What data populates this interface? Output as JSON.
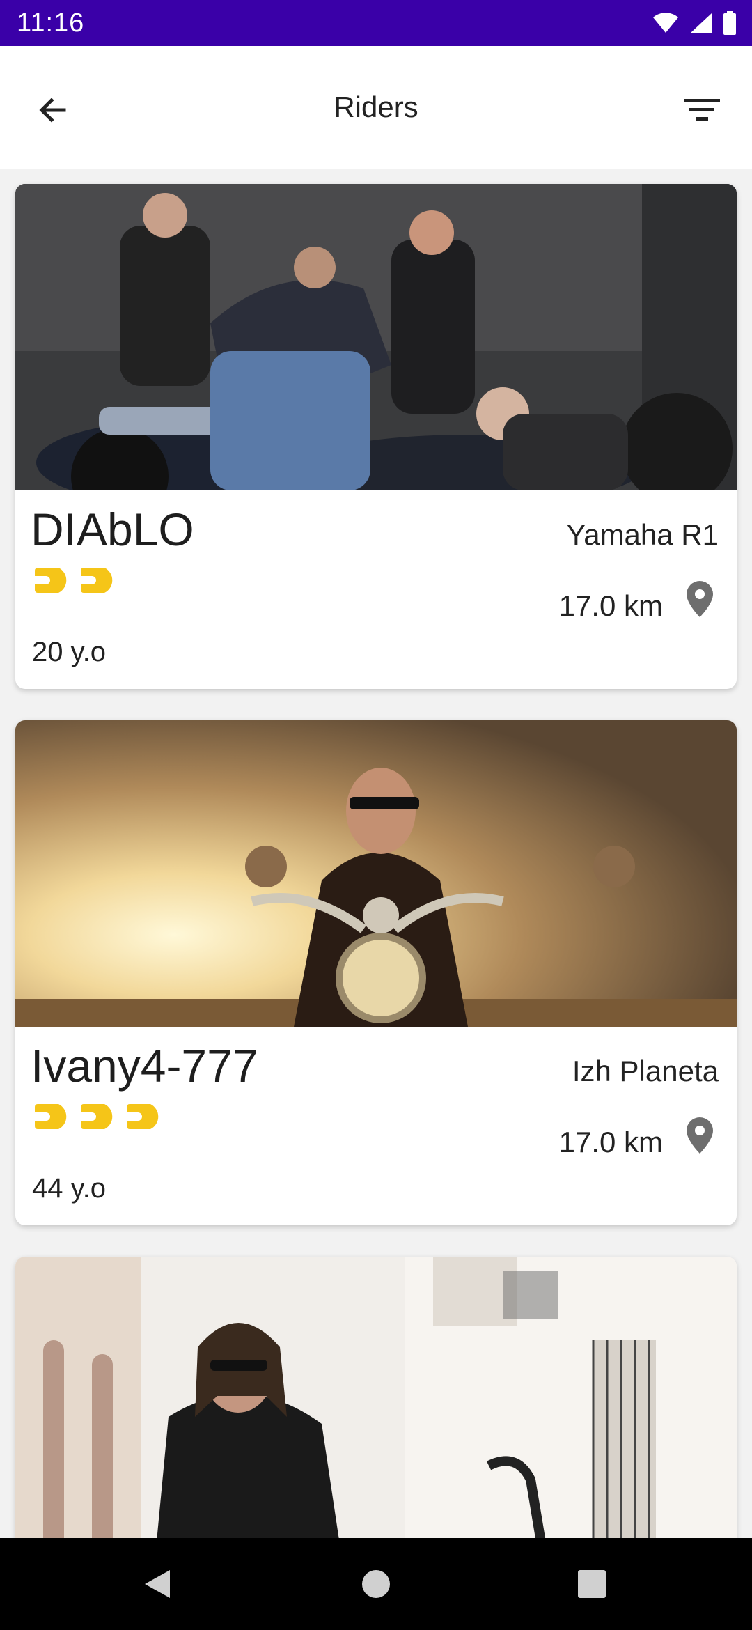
{
  "status_bar": {
    "time": "11:16",
    "background": "#3a00a8",
    "icons": [
      "wifi-icon",
      "signal-icon",
      "battery-icon"
    ]
  },
  "app_bar": {
    "title": "Riders",
    "back_icon": "arrow-left-icon",
    "filter_icon": "filter-icon"
  },
  "riders": [
    {
      "name": "DIAbLO",
      "bike": "Yamaha R1",
      "rating_count": 2,
      "distance": "17.0 km",
      "age": "20 y.o",
      "photo": "group-of-bikers-photo"
    },
    {
      "name": "Ivany4-777",
      "bike": "Izh Planeta",
      "rating_count": 3,
      "distance": "17.0 km",
      "age": "44 y.o",
      "photo": "biker-on-motorcycle-sunset-photo"
    },
    {
      "photo": "biker-in-street-photo"
    }
  ],
  "accent_color": "#f5c518",
  "nav_bar": {
    "icons": [
      "back-triangle-icon",
      "home-circle-icon",
      "recents-square-icon"
    ]
  }
}
